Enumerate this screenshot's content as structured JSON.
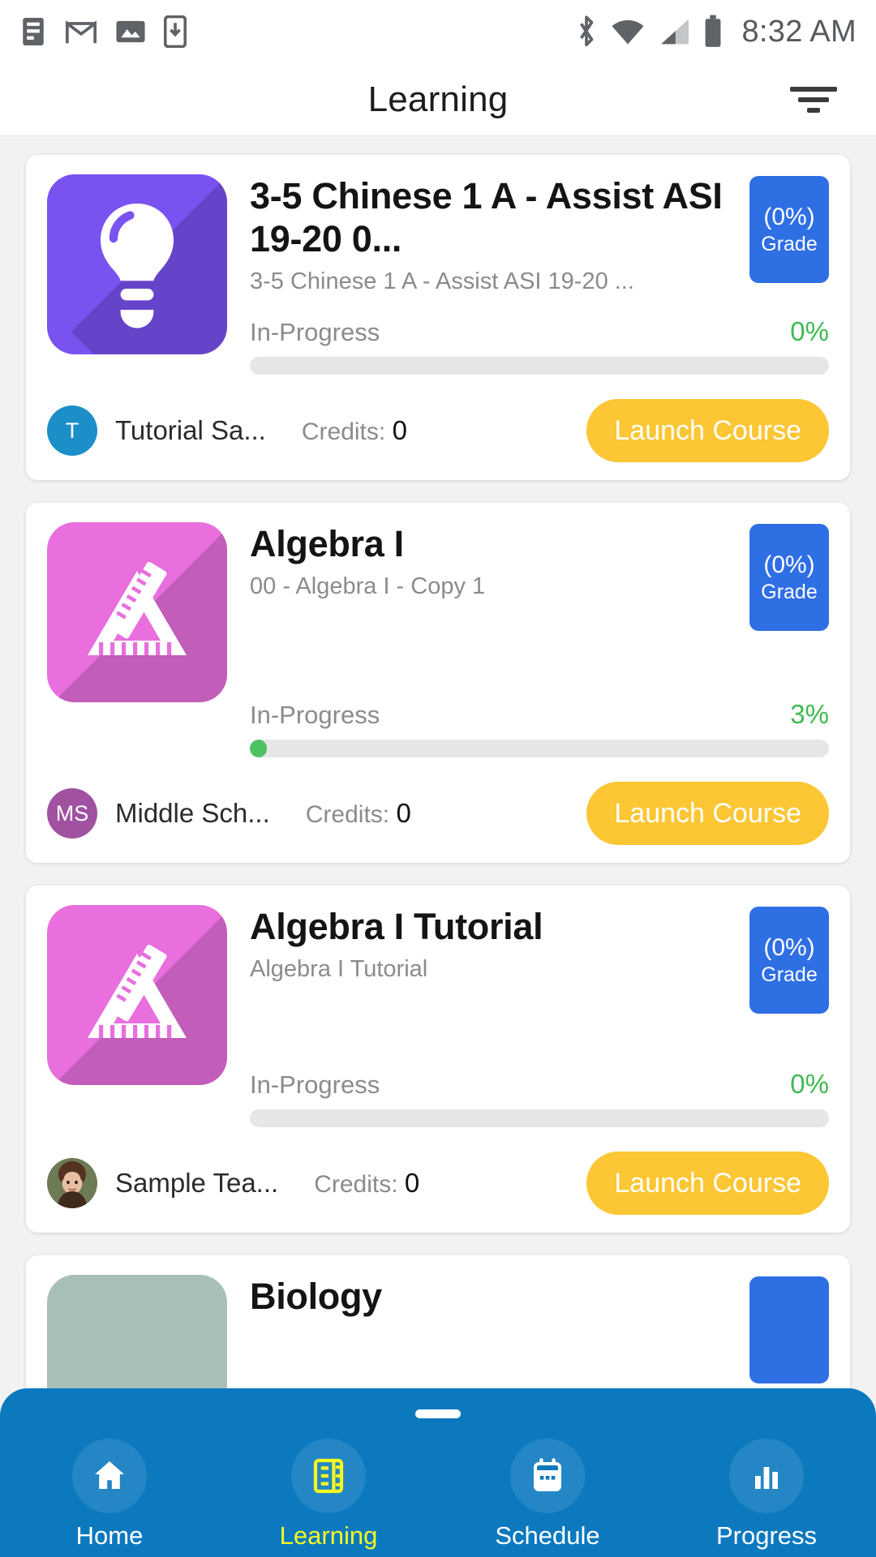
{
  "status_bar": {
    "time": "8:32 AM",
    "notification_icons": [
      "news-icon",
      "gmail-icon",
      "photos-icon",
      "download-icon"
    ],
    "system_icons": [
      "bluetooth-icon",
      "wifi-icon",
      "cellular-signal-icon",
      "battery-icon"
    ]
  },
  "app_bar": {
    "title": "Learning",
    "filter_icon": "filter-icon"
  },
  "colors": {
    "grade_badge_blue": "#2f6fe4",
    "launch_button_yellow": "#fcc634",
    "progress_green": "#4cc263",
    "bottom_nav_blue": "#0c79bf",
    "active_nav_yellow": "#f6f820",
    "icon_purple": "#7a52f0",
    "icon_pink": "#e86fdd"
  },
  "courses": [
    {
      "title": "3-5 Chinese 1 A - Assist ASI 19-20 0...",
      "subtitle": "3-5 Chinese 1 A - Assist ASI 19-20 ...",
      "grade_value": "(0%)",
      "grade_label": "Grade",
      "status": "In-Progress",
      "progress_pct": "0%",
      "progress_value": 0,
      "instructor": "Tutorial Sa...",
      "avatar_initials": "T",
      "avatar_color": "#1c8fc9",
      "avatar_type": "initials",
      "credits_label": "Credits:",
      "credits_value": "0",
      "launch_label": "Launch Course",
      "icon_name": "lightbulb-icon",
      "icon_bg": "#7a52f0"
    },
    {
      "title": "Algebra I",
      "subtitle": "00 - Algebra I - Copy 1",
      "grade_value": "(0%)",
      "grade_label": "Grade",
      "status": "In-Progress",
      "progress_pct": "3%",
      "progress_value": 3,
      "instructor": "Middle Sch...",
      "avatar_initials": "MS",
      "avatar_color": "#a052a0",
      "avatar_type": "initials",
      "credits_label": "Credits:",
      "credits_value": "0",
      "launch_label": "Launch Course",
      "icon_name": "ruler-triangle-icon",
      "icon_bg": "#e86fdd"
    },
    {
      "title": "Algebra I Tutorial",
      "subtitle": "Algebra I Tutorial",
      "grade_value": "(0%)",
      "grade_label": "Grade",
      "status": "In-Progress",
      "progress_pct": "0%",
      "progress_value": 0,
      "instructor": "Sample Tea...",
      "avatar_initials": "",
      "avatar_color": "#c8b4a0",
      "avatar_type": "photo",
      "credits_label": "Credits:",
      "credits_value": "0",
      "launch_label": "Launch Course",
      "icon_name": "ruler-triangle-icon",
      "icon_bg": "#e86fdd"
    }
  ],
  "bottom_nav": {
    "items": [
      {
        "label": "Home",
        "icon": "home-icon",
        "active": false
      },
      {
        "label": "Learning",
        "icon": "book-icon",
        "active": true
      },
      {
        "label": "Schedule",
        "icon": "calendar-icon",
        "active": false
      },
      {
        "label": "Progress",
        "icon": "bar-chart-icon",
        "active": false
      }
    ]
  }
}
